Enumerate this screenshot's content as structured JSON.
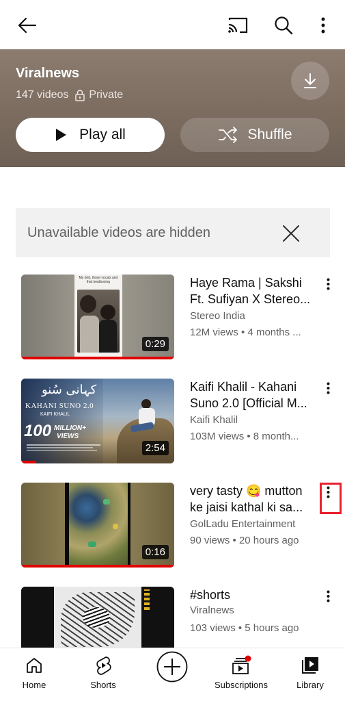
{
  "topbar": {
    "back_icon": "arrow-left-icon",
    "cast_icon": "cast-icon",
    "search_icon": "search-icon",
    "more_icon": "more-vert-icon"
  },
  "playlist": {
    "title": "Viralnews",
    "video_count": "147 videos",
    "privacy": "Private",
    "play_all_label": "Play all",
    "shuffle_label": "Shuffle",
    "header_color": "#7c6c60"
  },
  "notice": {
    "text": "Unavailable videos are hidden"
  },
  "videos": [
    {
      "title_line1": "Haye Rama | Sakshi",
      "title_line2": "Ft. Sufiyan X Stereo...",
      "channel": "Stereo India",
      "stats": "12M views • 4 months ...",
      "duration": "0:29",
      "progress": 1.0,
      "thumb_caption": "My bird, those vocals and that beatboxing"
    },
    {
      "title_line1": "Kaifi Khalil - Kahani",
      "title_line2": "Suno 2.0 [Official M...",
      "channel": "Kaifi Khalil",
      "stats": "103M views • 8 month...",
      "duration": "2:54",
      "progress": 0.1,
      "thumb_urdu": "کہانی سُنو",
      "thumb_song": "KAHANI SUNO 2.0",
      "thumb_artist": "KAIFI KHALIL",
      "thumb_views_num": "100",
      "thumb_views_word": "MILLION+",
      "thumb_views_sub": "VIEWS"
    },
    {
      "title_line1": "very tasty 😋 mutton",
      "title_line2": "ke jaisi kathal ki sa...",
      "channel": "GolLadu Entertainment",
      "stats": "90 views • 20 hours ago",
      "duration": "0:16",
      "progress": 1.0
    },
    {
      "title_line1": "#shorts",
      "title_line2": "",
      "channel": "Viralnews",
      "stats": "103 views • 5 hours ago",
      "duration": "",
      "progress": 0
    }
  ],
  "bottom_nav": {
    "home": "Home",
    "shorts": "Shorts",
    "subscriptions": "Subscriptions",
    "library": "Library"
  },
  "colors": {
    "accent_red": "#e00000",
    "highlight_box": "#e8202f",
    "secondary_text": "#606060"
  }
}
